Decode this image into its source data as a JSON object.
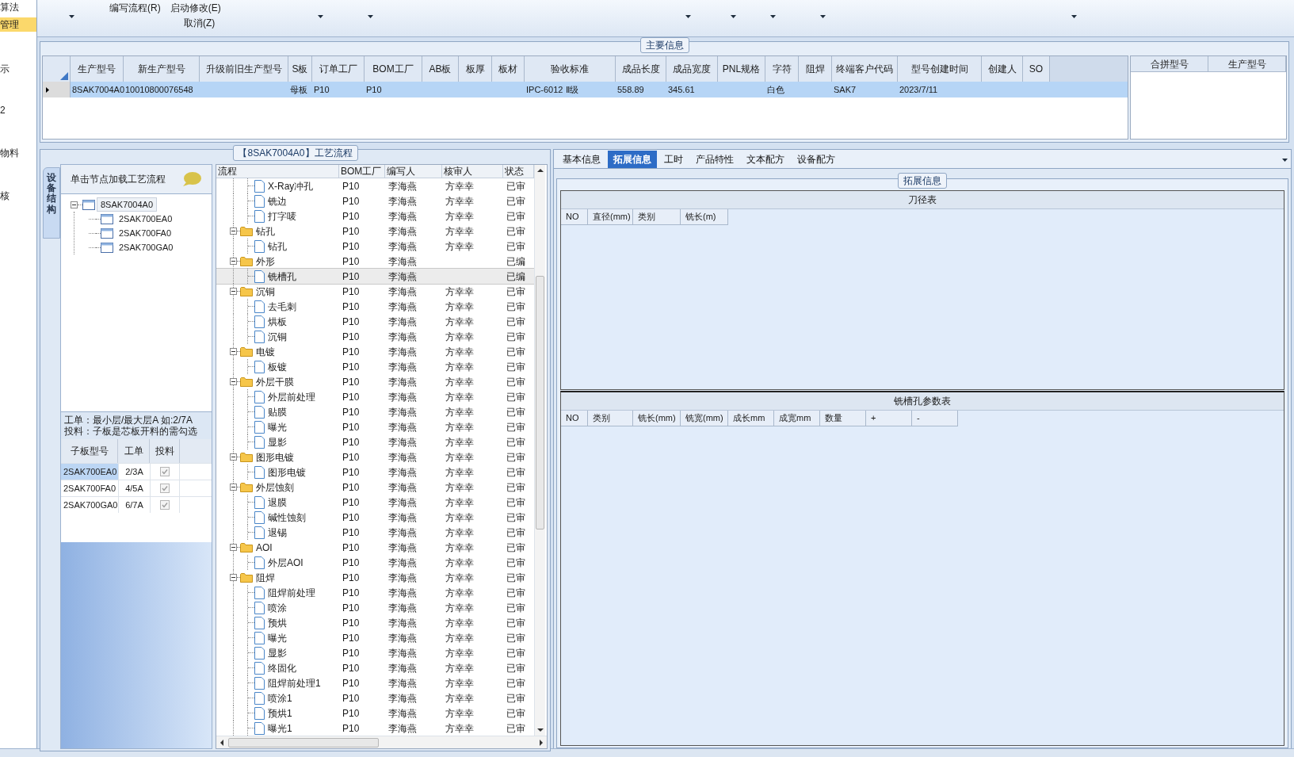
{
  "sidebar": {
    "items": [
      {
        "label": "算法",
        "selected": false
      },
      {
        "label": "管理",
        "selected": true
      },
      {
        "label": "示",
        "selected": false
      },
      {
        "label": "2",
        "selected": false
      },
      {
        "label": "物料",
        "selected": false
      },
      {
        "label": "核",
        "selected": false
      }
    ]
  },
  "toolbar": {
    "buttons": [
      "编写流程(R)",
      "启动修改(E)",
      "取消(Z)"
    ]
  },
  "main_info": {
    "title": "主要信息",
    "table": {
      "columns": [
        "生产型号",
        "新生产型号",
        "升级前旧生产型号",
        "S板",
        "订单工厂",
        "BOM工厂",
        "AB板",
        "板厚",
        "板材",
        "验收标准",
        "成品长度",
        "成品宽度",
        "PNL规格",
        "字符",
        "阻焊",
        "终端客户代码",
        "型号创建时间",
        "创建人",
        "SO"
      ],
      "rows": [
        {
          "selected": true,
          "cells": [
            "8SAK7004A0",
            "10010800076548",
            null,
            "母板",
            "P10",
            "P10",
            null,
            null,
            null,
            "IPC-6012 Ⅱ级",
            "558.89",
            "345.61",
            null,
            "白色",
            null,
            "SAK7",
            "2023/7/11",
            null,
            null
          ]
        }
      ]
    },
    "merge_table": {
      "columns": [
        "合拼型号",
        "生产型号"
      ]
    }
  },
  "process": {
    "title": "【8SAK7004A0】工艺流程",
    "side_tab": "设备结构",
    "hint": "单击节点加载工艺流程",
    "structure_tree": [
      {
        "label": "8SAK7004A0",
        "selected": true,
        "expanded": true,
        "children": [
          {
            "label": "2SAK700EA0",
            "selected": false
          },
          {
            "label": "2SAK700FA0",
            "selected": false
          },
          {
            "label": "2SAK700GA0",
            "selected": false
          }
        ]
      }
    ],
    "note": [
      "工单：最小层/最大层A 如:2/7A",
      "投料：子板是芯板开料的需勾选"
    ],
    "sub_boards": {
      "columns": [
        "子板型号",
        "工单",
        "投料"
      ],
      "rows": [
        {
          "board": "2SAK700EA0",
          "order": "2/3A",
          "feed": true,
          "selected": true
        },
        {
          "board": "2SAK700FA0",
          "order": "4/5A",
          "feed": true,
          "selected": false
        },
        {
          "board": "2SAK700GA0",
          "order": "6/7A",
          "feed": true,
          "selected": false
        }
      ]
    },
    "flow": {
      "columns": [
        "流程",
        "BOM工厂",
        "编写人",
        "核审人",
        "状态"
      ],
      "continued": [
        {
          "name": "X-Ray冲孔",
          "bom": "P10",
          "writer": "李海燕",
          "reviewer": "方幸幸",
          "status": "已审",
          "selected": false
        },
        {
          "name": "铣边",
          "bom": "P10",
          "writer": "李海燕",
          "reviewer": "方幸幸",
          "status": "已审",
          "selected": false
        },
        {
          "name": "打字唛",
          "bom": "P10",
          "writer": "李海燕",
          "reviewer": "方幸幸",
          "status": "已审",
          "selected": false
        }
      ],
      "groups": [
        {
          "name": "钻孔",
          "bom": "P10",
          "writer": "李海燕",
          "reviewer": "方幸幸",
          "status": "已审",
          "selected": false,
          "expanded": true,
          "children": [
            {
              "name": "钻孔",
              "bom": "P10",
              "writer": "李海燕",
              "reviewer": "方幸幸",
              "status": "已审",
              "selected": false
            }
          ]
        },
        {
          "name": "外形",
          "bom": "P10",
          "writer": "李海燕",
          "status": "已编",
          "selected": false,
          "expanded": true,
          "children": [
            {
              "name": "铣槽孔",
              "bom": "P10",
              "writer": "李海燕",
              "status": "已编",
              "selected": true
            }
          ]
        },
        {
          "name": "沉铜",
          "bom": "P10",
          "writer": "李海燕",
          "reviewer": "方幸幸",
          "status": "已审",
          "selected": false,
          "expanded": true,
          "children": [
            {
              "name": "去毛刺",
              "bom": "P10",
              "writer": "李海燕",
              "reviewer": "方幸幸",
              "status": "已审",
              "selected": false
            },
            {
              "name": "烘板",
              "bom": "P10",
              "writer": "李海燕",
              "reviewer": "方幸幸",
              "status": "已审",
              "selected": false
            },
            {
              "name": "沉铜",
              "bom": "P10",
              "writer": "李海燕",
              "reviewer": "方幸幸",
              "status": "已审",
              "selected": false
            }
          ]
        },
        {
          "name": "电镀",
          "bom": "P10",
          "writer": "李海燕",
          "reviewer": "方幸幸",
          "status": "已审",
          "selected": false,
          "expanded": true,
          "children": [
            {
              "name": "板镀",
              "bom": "P10",
              "writer": "李海燕",
              "reviewer": "方幸幸",
              "status": "已审",
              "selected": false
            }
          ]
        },
        {
          "name": "外层干膜",
          "bom": "P10",
          "writer": "李海燕",
          "reviewer": "方幸幸",
          "status": "已审",
          "selected": false,
          "expanded": true,
          "children": [
            {
              "name": "外层前处理",
              "bom": "P10",
              "writer": "李海燕",
              "reviewer": "方幸幸",
              "status": "已审",
              "selected": false
            },
            {
              "name": "贴膜",
              "bom": "P10",
              "writer": "李海燕",
              "reviewer": "方幸幸",
              "status": "已审",
              "selected": false
            },
            {
              "name": "曝光",
              "bom": "P10",
              "writer": "李海燕",
              "reviewer": "方幸幸",
              "status": "已审",
              "selected": false
            },
            {
              "name": "显影",
              "bom": "P10",
              "writer": "李海燕",
              "reviewer": "方幸幸",
              "status": "已审",
              "selected": false
            }
          ]
        },
        {
          "name": "图形电镀",
          "bom": "P10",
          "writer": "李海燕",
          "reviewer": "方幸幸",
          "status": "已审",
          "selected": false,
          "expanded": true,
          "children": [
            {
              "name": "图形电镀",
              "bom": "P10",
              "writer": "李海燕",
              "reviewer": "方幸幸",
              "status": "已审",
              "selected": false
            }
          ]
        },
        {
          "name": "外层蚀刻",
          "bom": "P10",
          "writer": "李海燕",
          "reviewer": "方幸幸",
          "status": "已审",
          "selected": false,
          "expanded": true,
          "children": [
            {
              "name": "退膜",
              "bom": "P10",
              "writer": "李海燕",
              "reviewer": "方幸幸",
              "status": "已审",
              "selected": false
            },
            {
              "name": "碱性蚀刻",
              "bom": "P10",
              "writer": "李海燕",
              "reviewer": "方幸幸",
              "status": "已审",
              "selected": false
            },
            {
              "name": "退锡",
              "bom": "P10",
              "writer": "李海燕",
              "reviewer": "方幸幸",
              "status": "已审",
              "selected": false
            }
          ]
        },
        {
          "name": "AOI",
          "bom": "P10",
          "writer": "李海燕",
          "reviewer": "方幸幸",
          "status": "已审",
          "selected": false,
          "expanded": true,
          "children": [
            {
              "name": "外层AOI",
              "bom": "P10",
              "writer": "李海燕",
              "reviewer": "方幸幸",
              "status": "已审",
              "selected": false
            }
          ]
        },
        {
          "name": "阻焊",
          "bom": "P10",
          "writer": "李海燕",
          "reviewer": "方幸幸",
          "status": "已审",
          "selected": false,
          "expanded": true,
          "children": [
            {
              "name": "阻焊前处理",
              "bom": "P10",
              "writer": "李海燕",
              "reviewer": "方幸幸",
              "status": "已审",
              "selected": false
            },
            {
              "name": "喷涂",
              "bom": "P10",
              "writer": "李海燕",
              "reviewer": "方幸幸",
              "status": "已审",
              "selected": false
            },
            {
              "name": "预烘",
              "bom": "P10",
              "writer": "李海燕",
              "reviewer": "方幸幸",
              "status": "已审",
              "selected": false
            },
            {
              "name": "曝光",
              "bom": "P10",
              "writer": "李海燕",
              "reviewer": "方幸幸",
              "status": "已审",
              "selected": false
            },
            {
              "name": "显影",
              "bom": "P10",
              "writer": "李海燕",
              "reviewer": "方幸幸",
              "status": "已审",
              "selected": false
            },
            {
              "name": "终固化",
              "bom": "P10",
              "writer": "李海燕",
              "reviewer": "方幸幸",
              "status": "已审",
              "selected": false
            },
            {
              "name": "阻焊前处理1",
              "bom": "P10",
              "writer": "李海燕",
              "reviewer": "方幸幸",
              "status": "已审",
              "selected": false
            },
            {
              "name": "喷涂1",
              "bom": "P10",
              "writer": "李海燕",
              "reviewer": "方幸幸",
              "status": "已审",
              "selected": false
            },
            {
              "name": "预烘1",
              "bom": "P10",
              "writer": "李海燕",
              "reviewer": "方幸幸",
              "status": "已审",
              "selected": false
            },
            {
              "name": "曝光1",
              "bom": "P10",
              "writer": "李海燕",
              "reviewer": "方幸幸",
              "status": "已审",
              "selected": false
            }
          ]
        }
      ]
    }
  },
  "detail": {
    "tabs": [
      {
        "label": "基本信息",
        "selected": false
      },
      {
        "label": "拓展信息",
        "selected": true
      },
      {
        "label": "工时",
        "selected": false
      },
      {
        "label": "产品特性",
        "selected": false
      },
      {
        "label": "文本配方",
        "selected": false
      },
      {
        "label": "设备配方",
        "selected": false
      }
    ],
    "group_title": "拓展信息",
    "cutter_table": {
      "title": "刀径表",
      "columns": [
        "NO",
        "直径(mm)",
        "类别",
        "铣长(m)"
      ]
    },
    "slot_table": {
      "title": "铣槽孔参数表",
      "columns": [
        "NO",
        "类别",
        "铣长(mm)",
        "铣宽(mm)",
        "成长mm",
        "成宽mm",
        "数量",
        "+",
        "-"
      ]
    }
  }
}
